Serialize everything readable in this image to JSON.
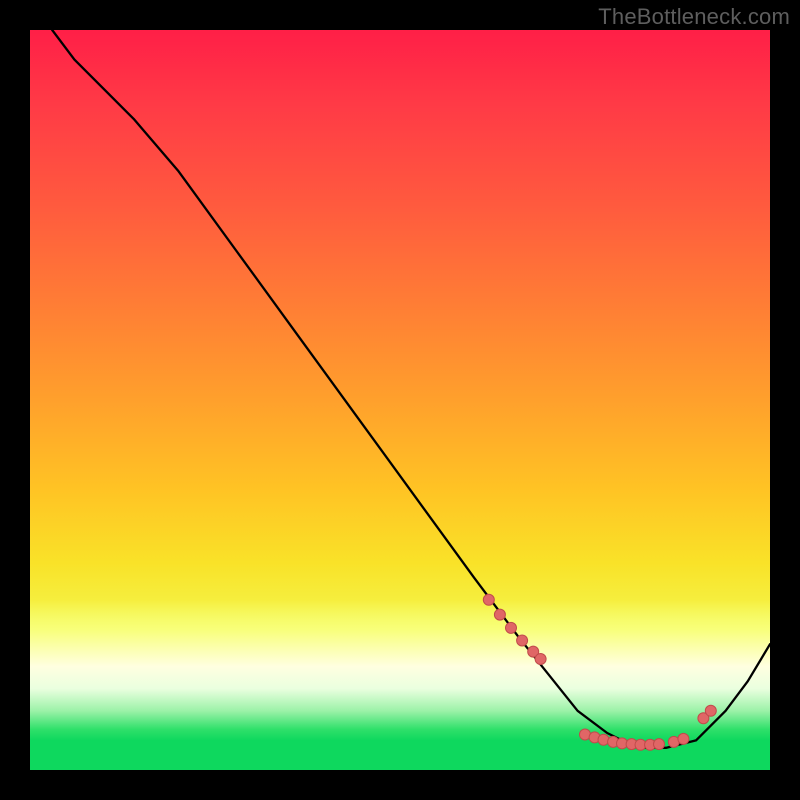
{
  "watermark": "TheBottleneck.com",
  "colors": {
    "page_bg": "#000000",
    "watermark_text": "#5e5e5e",
    "curve_stroke": "#000000",
    "dot_fill": "#e06666",
    "dot_stroke": "#c14b4b"
  },
  "chart_data": {
    "type": "line",
    "title": "",
    "xlabel": "",
    "ylabel": "",
    "xlim": [
      0,
      100
    ],
    "ylim": [
      0,
      100
    ],
    "grid": false,
    "note": "Axes are unlabeled in the source image; x/y are normalized 0–100 estimates read off the plot area. y is 'up is higher'.",
    "curve": {
      "x": [
        3,
        6,
        10,
        14,
        20,
        28,
        36,
        44,
        52,
        60,
        66,
        70,
        74,
        78,
        82,
        86,
        90,
        94,
        97,
        100
      ],
      "y": [
        100,
        96,
        92,
        88,
        81,
        70,
        59,
        48,
        37,
        26,
        18,
        13,
        8,
        5,
        3,
        3,
        4,
        8,
        12,
        17
      ]
    },
    "highlight_points": {
      "x": [
        62,
        63.5,
        65,
        66.5,
        68,
        69,
        75,
        76.3,
        77.5,
        78.8,
        80,
        81.3,
        82.5,
        83.8,
        85,
        87,
        88.3,
        91,
        92
      ],
      "y": [
        23,
        21,
        19.2,
        17.5,
        16,
        15,
        4.8,
        4.4,
        4.1,
        3.8,
        3.6,
        3.5,
        3.4,
        3.4,
        3.5,
        3.8,
        4.2,
        7,
        8
      ]
    }
  }
}
